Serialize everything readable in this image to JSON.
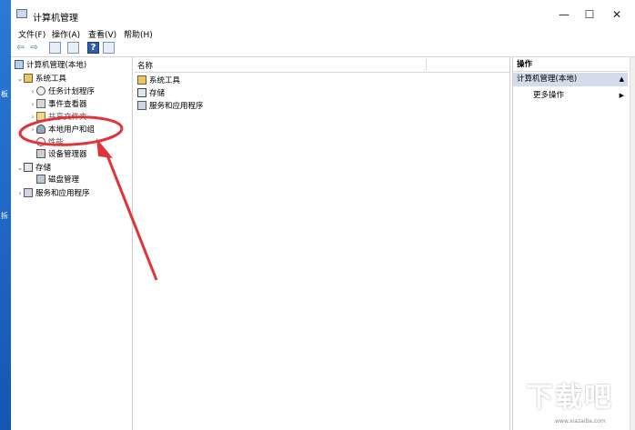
{
  "desktop": {
    "labels": [
      "板",
      "拆"
    ]
  },
  "window": {
    "title": "计算机管理",
    "controls": {
      "minimize": "—",
      "maximize": "☐",
      "close": "✕"
    }
  },
  "menu": [
    "文件(F)",
    "操作(A)",
    "查看(V)",
    "帮助(H)"
  ],
  "toolbar": {
    "back": "⇦",
    "forward": "⇨",
    "help": "?"
  },
  "tree": {
    "root": "计算机管理(本地)",
    "system_tools": "系统工具",
    "task_scheduler": "任务计划程序",
    "event_viewer": "事件查看器",
    "shared_folders": "共享文件夹",
    "local_users": "本地用户和组",
    "performance": "性能",
    "device_manager": "设备管理器",
    "storage": "存储",
    "disk_management": "磁盘管理",
    "services_apps": "服务和应用程序"
  },
  "middle": {
    "column_name": "名称",
    "items": [
      "系统工具",
      "存储",
      "服务和应用程序"
    ]
  },
  "actions": {
    "header": "操作",
    "selected": "计算机管理(本地)",
    "more": "更多操作"
  },
  "annotation": {
    "color": "#e0333a"
  },
  "watermark": {
    "text": "下载吧",
    "small": "www.xiazaiba.com"
  }
}
